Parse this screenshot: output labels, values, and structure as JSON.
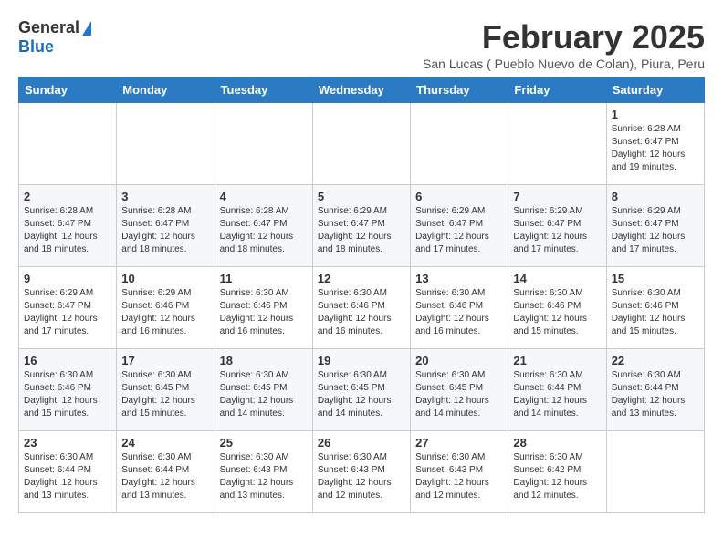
{
  "logo": {
    "general": "General",
    "blue": "Blue"
  },
  "title": "February 2025",
  "subtitle": "San Lucas ( Pueblo Nuevo de Colan), Piura, Peru",
  "days_of_week": [
    "Sunday",
    "Monday",
    "Tuesday",
    "Wednesday",
    "Thursday",
    "Friday",
    "Saturday"
  ],
  "weeks": [
    [
      {
        "day": "",
        "info": ""
      },
      {
        "day": "",
        "info": ""
      },
      {
        "day": "",
        "info": ""
      },
      {
        "day": "",
        "info": ""
      },
      {
        "day": "",
        "info": ""
      },
      {
        "day": "",
        "info": ""
      },
      {
        "day": "1",
        "info": "Sunrise: 6:28 AM\nSunset: 6:47 PM\nDaylight: 12 hours\nand 19 minutes."
      }
    ],
    [
      {
        "day": "2",
        "info": "Sunrise: 6:28 AM\nSunset: 6:47 PM\nDaylight: 12 hours\nand 18 minutes."
      },
      {
        "day": "3",
        "info": "Sunrise: 6:28 AM\nSunset: 6:47 PM\nDaylight: 12 hours\nand 18 minutes."
      },
      {
        "day": "4",
        "info": "Sunrise: 6:28 AM\nSunset: 6:47 PM\nDaylight: 12 hours\nand 18 minutes."
      },
      {
        "day": "5",
        "info": "Sunrise: 6:29 AM\nSunset: 6:47 PM\nDaylight: 12 hours\nand 18 minutes."
      },
      {
        "day": "6",
        "info": "Sunrise: 6:29 AM\nSunset: 6:47 PM\nDaylight: 12 hours\nand 17 minutes."
      },
      {
        "day": "7",
        "info": "Sunrise: 6:29 AM\nSunset: 6:47 PM\nDaylight: 12 hours\nand 17 minutes."
      },
      {
        "day": "8",
        "info": "Sunrise: 6:29 AM\nSunset: 6:47 PM\nDaylight: 12 hours\nand 17 minutes."
      }
    ],
    [
      {
        "day": "9",
        "info": "Sunrise: 6:29 AM\nSunset: 6:47 PM\nDaylight: 12 hours\nand 17 minutes."
      },
      {
        "day": "10",
        "info": "Sunrise: 6:29 AM\nSunset: 6:46 PM\nDaylight: 12 hours\nand 16 minutes."
      },
      {
        "day": "11",
        "info": "Sunrise: 6:30 AM\nSunset: 6:46 PM\nDaylight: 12 hours\nand 16 minutes."
      },
      {
        "day": "12",
        "info": "Sunrise: 6:30 AM\nSunset: 6:46 PM\nDaylight: 12 hours\nand 16 minutes."
      },
      {
        "day": "13",
        "info": "Sunrise: 6:30 AM\nSunset: 6:46 PM\nDaylight: 12 hours\nand 16 minutes."
      },
      {
        "day": "14",
        "info": "Sunrise: 6:30 AM\nSunset: 6:46 PM\nDaylight: 12 hours\nand 15 minutes."
      },
      {
        "day": "15",
        "info": "Sunrise: 6:30 AM\nSunset: 6:46 PM\nDaylight: 12 hours\nand 15 minutes."
      }
    ],
    [
      {
        "day": "16",
        "info": "Sunrise: 6:30 AM\nSunset: 6:46 PM\nDaylight: 12 hours\nand 15 minutes."
      },
      {
        "day": "17",
        "info": "Sunrise: 6:30 AM\nSunset: 6:45 PM\nDaylight: 12 hours\nand 15 minutes."
      },
      {
        "day": "18",
        "info": "Sunrise: 6:30 AM\nSunset: 6:45 PM\nDaylight: 12 hours\nand 14 minutes."
      },
      {
        "day": "19",
        "info": "Sunrise: 6:30 AM\nSunset: 6:45 PM\nDaylight: 12 hours\nand 14 minutes."
      },
      {
        "day": "20",
        "info": "Sunrise: 6:30 AM\nSunset: 6:45 PM\nDaylight: 12 hours\nand 14 minutes."
      },
      {
        "day": "21",
        "info": "Sunrise: 6:30 AM\nSunset: 6:44 PM\nDaylight: 12 hours\nand 14 minutes."
      },
      {
        "day": "22",
        "info": "Sunrise: 6:30 AM\nSunset: 6:44 PM\nDaylight: 12 hours\nand 13 minutes."
      }
    ],
    [
      {
        "day": "23",
        "info": "Sunrise: 6:30 AM\nSunset: 6:44 PM\nDaylight: 12 hours\nand 13 minutes."
      },
      {
        "day": "24",
        "info": "Sunrise: 6:30 AM\nSunset: 6:44 PM\nDaylight: 12 hours\nand 13 minutes."
      },
      {
        "day": "25",
        "info": "Sunrise: 6:30 AM\nSunset: 6:43 PM\nDaylight: 12 hours\nand 13 minutes."
      },
      {
        "day": "26",
        "info": "Sunrise: 6:30 AM\nSunset: 6:43 PM\nDaylight: 12 hours\nand 12 minutes."
      },
      {
        "day": "27",
        "info": "Sunrise: 6:30 AM\nSunset: 6:43 PM\nDaylight: 12 hours\nand 12 minutes."
      },
      {
        "day": "28",
        "info": "Sunrise: 6:30 AM\nSunset: 6:42 PM\nDaylight: 12 hours\nand 12 minutes."
      },
      {
        "day": "",
        "info": ""
      }
    ]
  ]
}
